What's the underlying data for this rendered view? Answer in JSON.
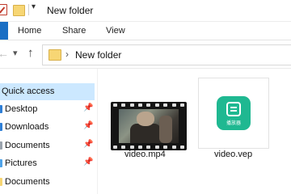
{
  "window": {
    "title": "New folder"
  },
  "ribbon": {
    "tabs": [
      {
        "label": "Home"
      },
      {
        "label": "Share"
      },
      {
        "label": "View"
      }
    ]
  },
  "address": {
    "path": "New folder"
  },
  "sidebar": {
    "quick_access": "Quick access",
    "items": [
      {
        "label": "Desktop",
        "pinned": true,
        "icon": "desktop-icon"
      },
      {
        "label": "Downloads",
        "pinned": true,
        "icon": "downloads-icon"
      },
      {
        "label": "Documents",
        "pinned": true,
        "icon": "documents-icon"
      },
      {
        "label": "Pictures",
        "pinned": true,
        "icon": "pictures-icon"
      },
      {
        "label": "Documents",
        "pinned": false,
        "icon": "folder-icon"
      }
    ]
  },
  "files": [
    {
      "name": "video.mp4",
      "type": "video",
      "icon": "video-thumbnail"
    },
    {
      "name": "video.vep",
      "type": "vep",
      "icon": "app-icon",
      "brand_text": "播放器"
    }
  ],
  "colors": {
    "accent": "#1a6ec4",
    "selection": "#cce8ff",
    "folder": "#f7d674",
    "vep_green": "#1fb891"
  }
}
